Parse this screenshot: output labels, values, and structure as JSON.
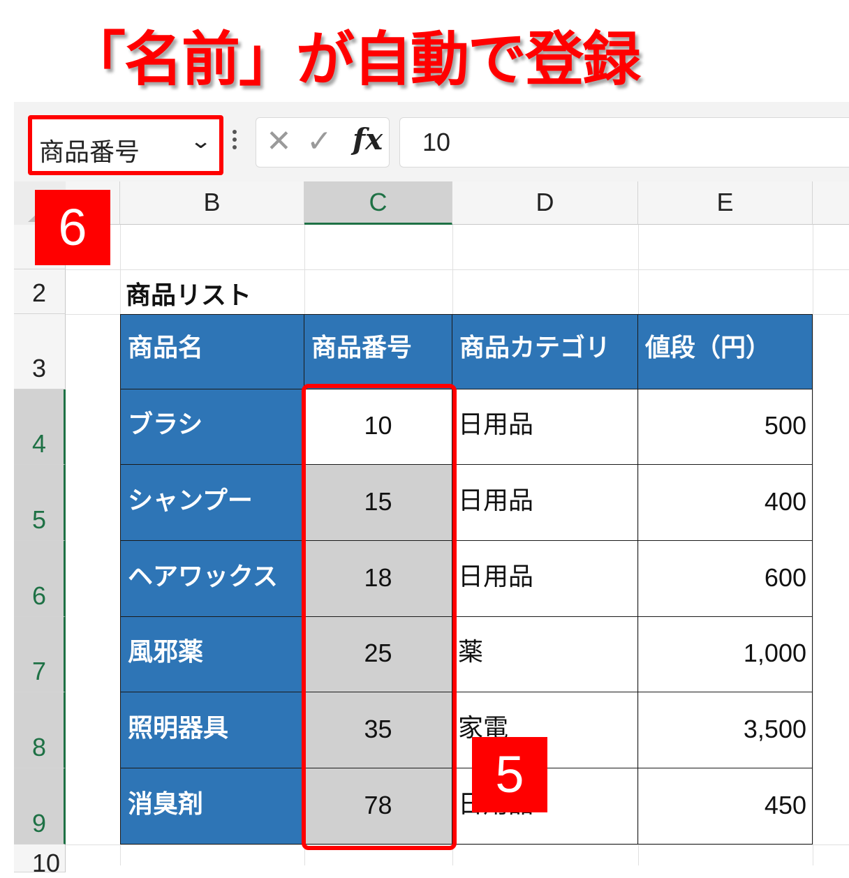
{
  "headline": "「名前」が自動で登録",
  "formula_bar": {
    "name_box_value": "商品番号",
    "formula_value": "10",
    "cancel_icon": "cross-icon",
    "enter_icon": "check-icon",
    "fx_label": "fx"
  },
  "columns": [
    "B",
    "C",
    "D",
    "E"
  ],
  "rows": [
    "2",
    "3",
    "4",
    "5",
    "6",
    "7",
    "8",
    "9",
    "10"
  ],
  "list_title": "商品リスト",
  "table": {
    "headers": [
      "商品名",
      "商品番号",
      "商品カテゴリ",
      "値段（円）"
    ],
    "rows": [
      {
        "name": "ブラシ",
        "number": "10",
        "category": "日用品",
        "price": "500"
      },
      {
        "name": "シャンプー",
        "number": "15",
        "category": "日用品",
        "price": "400"
      },
      {
        "name": "ヘアワックス",
        "number": "18",
        "category": "日用品",
        "price": "600"
      },
      {
        "name": "風邪薬",
        "number": "25",
        "category": "薬",
        "price": "1,000"
      },
      {
        "name": "照明器具",
        "number": "35",
        "category": "家電",
        "price": "3,500"
      },
      {
        "name": "消臭剤",
        "number": "78",
        "category": "日用品",
        "price": "450"
      }
    ]
  },
  "badges": {
    "step_name_box": "6",
    "step_selection": "5"
  },
  "colors": {
    "highlight": "#ff0000",
    "table_header": "#2e75b6",
    "selection_green": "#1e7145"
  }
}
